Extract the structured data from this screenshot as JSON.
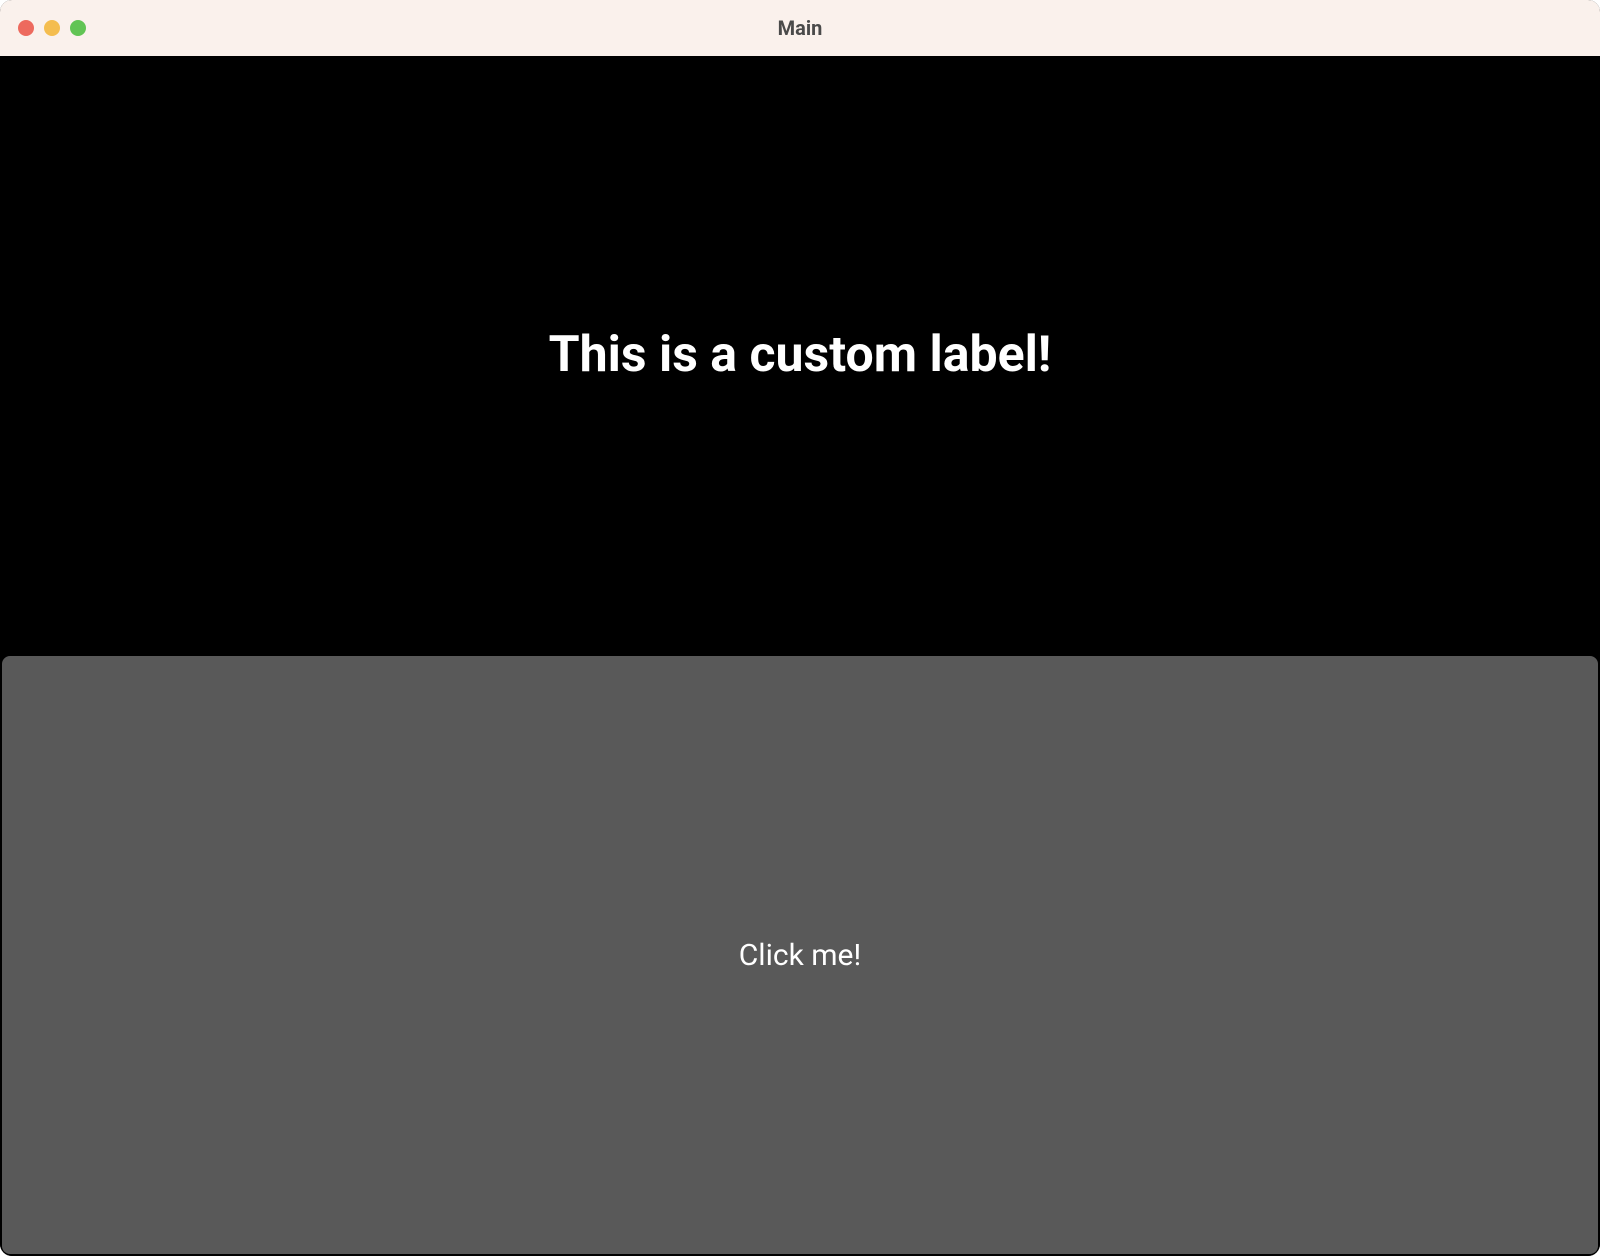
{
  "window": {
    "title": "Main"
  },
  "content": {
    "label_text": "This is a custom label!",
    "button_label": "Click me!"
  }
}
